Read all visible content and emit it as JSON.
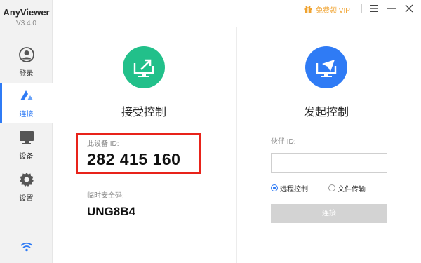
{
  "app": {
    "name": "AnyViewer",
    "version": "V3.4.0"
  },
  "sidebar": {
    "items": [
      {
        "label": "登录",
        "icon": "user-icon",
        "active": false
      },
      {
        "label": "连接",
        "icon": "connect-icon",
        "active": true
      },
      {
        "label": "设备",
        "icon": "monitor-icon",
        "active": false
      },
      {
        "label": "设置",
        "icon": "gear-icon",
        "active": false
      }
    ],
    "status_icon": "wifi-icon"
  },
  "topbar": {
    "vip_label": "免费领 VIP",
    "vip_icon": "gift-icon",
    "menu_icon": "menu-icon",
    "minimize_icon": "minimize-icon",
    "close_icon": "close-icon"
  },
  "left_panel": {
    "title": "接受控制",
    "icon": "screen-share-icon",
    "id_label": "此设备 ID:",
    "device_id": "282 415 160",
    "password_label": "临时安全码:",
    "password": "UNG8B4"
  },
  "right_panel": {
    "title": "发起控制",
    "icon": "remote-send-icon",
    "partner_label": "伙伴 ID:",
    "partner_value": "",
    "partner_placeholder": "",
    "options": [
      {
        "label": "远程控制",
        "checked": true
      },
      {
        "label": "文件传输",
        "checked": false
      }
    ],
    "connect_label": "连接"
  },
  "colors": {
    "accent": "#2f7bf5",
    "green": "#22c08a",
    "blue": "#2f7bf5",
    "highlight": "#e8231a",
    "vip": "#f0a330"
  }
}
